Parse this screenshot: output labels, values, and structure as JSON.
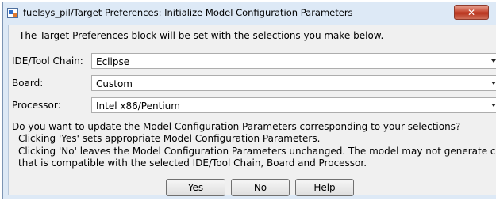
{
  "window": {
    "title": "fuelsys_pil/Target Preferences: Initialize Model Configuration Parameters",
    "close_label": "✕"
  },
  "intro": "The Target Preferences block will be set with the selections you make below.",
  "fields": [
    {
      "label": "IDE/Tool Chain:",
      "value": "Eclipse"
    },
    {
      "label": "Board:",
      "value": "Custom"
    },
    {
      "label": "Processor:",
      "value": "Intel x86/Pentium"
    }
  ],
  "message": {
    "question": "Do you want to update the Model Configuration Parameters corresponding to your selections?",
    "yes_line": "Clicking 'Yes' sets appropriate Model Configuration Parameters.",
    "no_line": "Clicking 'No' leaves the Model Configuration Parameters unchanged.  The model may not generate code",
    "no_line_cont": "that is compatible with the selected IDE/Tool Chain, Board and Processor."
  },
  "buttons": {
    "yes": "Yes",
    "no": "No",
    "help": "Help"
  }
}
